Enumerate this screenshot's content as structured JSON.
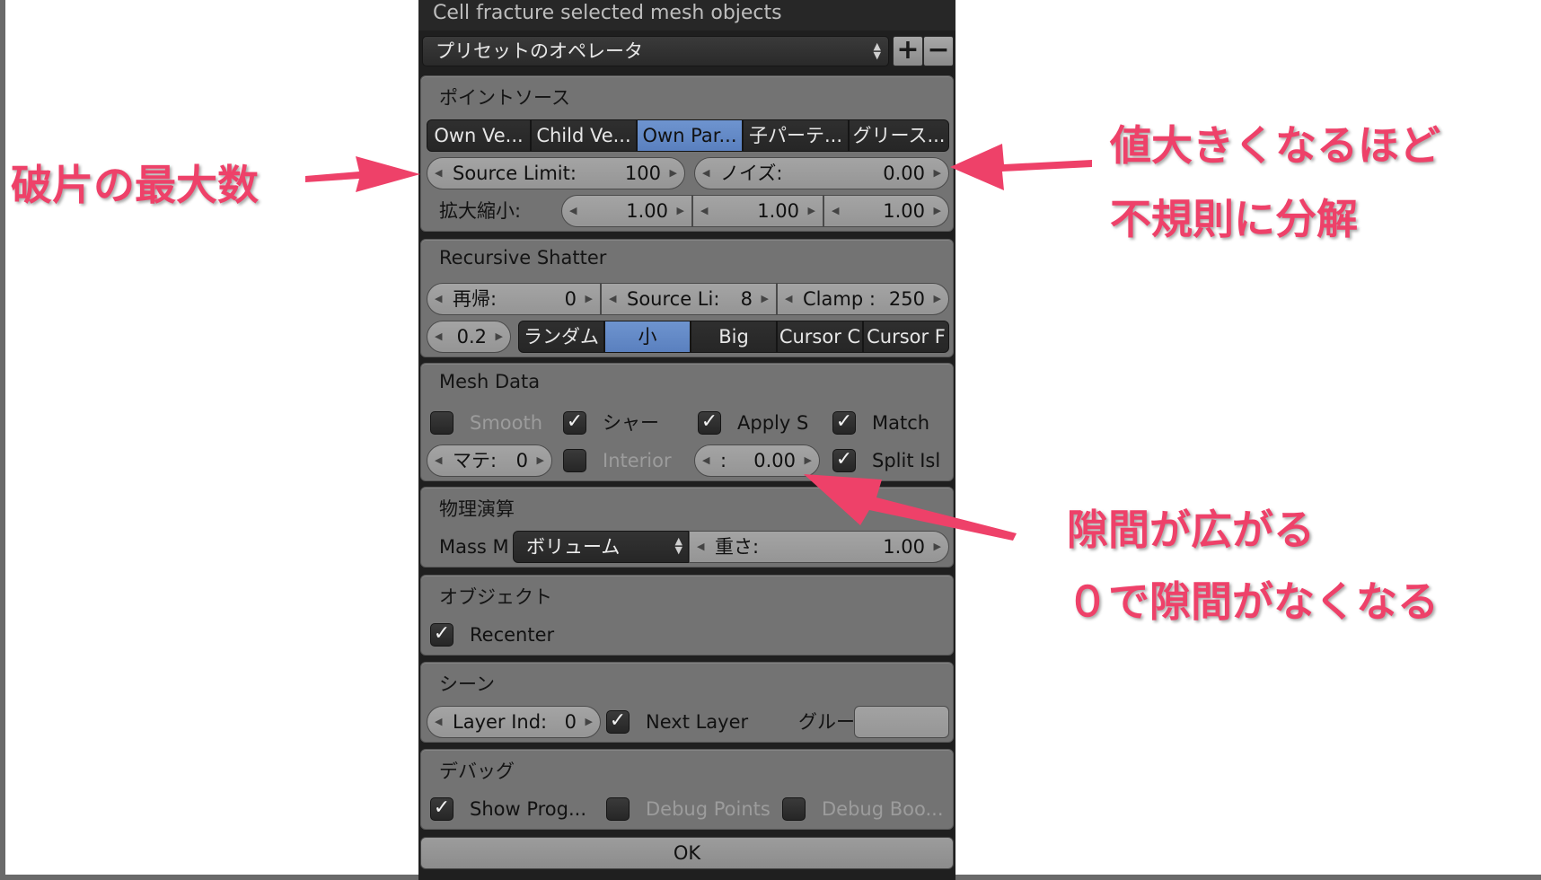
{
  "dialog": {
    "title": "Cell fracture selected mesh objects",
    "preset": "プリセットのオペレータ",
    "add_label": "+",
    "remove_label": "−",
    "ok_label": "OK"
  },
  "point_source": {
    "title": "ポイントソース",
    "tabs": [
      {
        "label": "Own Ve...",
        "active": false
      },
      {
        "label": "Child Ve...",
        "active": false
      },
      {
        "label": "Own Par...",
        "active": true
      },
      {
        "label": "子パーテ...",
        "active": false
      },
      {
        "label": "グリース...",
        "active": false
      }
    ],
    "source_limit": {
      "label": "Source Limit:",
      "value": "100"
    },
    "noise": {
      "label": "ノイズ:",
      "value": "0.00"
    },
    "scale": {
      "label": "拡大縮小:",
      "x": "1.00",
      "y": "1.00",
      "z": "1.00"
    }
  },
  "recursive": {
    "title": "Recursive Shatter",
    "recursion": {
      "label": "再帰:",
      "value": "0"
    },
    "source_limit": {
      "label": "Source Li:",
      "value": "8"
    },
    "clamp": {
      "label": "Clamp :",
      "value": "250"
    },
    "chance": {
      "value": "0.2"
    },
    "modes": [
      {
        "label": "ランダム",
        "active": false
      },
      {
        "label": "小",
        "active": true
      },
      {
        "label": "Big",
        "active": false
      },
      {
        "label": "Cursor C",
        "active": false
      },
      {
        "label": "Cursor F",
        "active": false
      }
    ]
  },
  "mesh_data": {
    "title": "Mesh Data",
    "smooth": {
      "label": "Smooth",
      "checked": false
    },
    "sharp": {
      "label": "シャー",
      "checked": true
    },
    "apply_s": {
      "label": "Apply S",
      "checked": true
    },
    "match": {
      "label": "Match",
      "checked": true
    },
    "material": {
      "label": "マテ:",
      "value": "0"
    },
    "interior": {
      "label": "Interior",
      "checked": false
    },
    "margin": {
      "label": ":",
      "value": "0.00"
    },
    "split_isl": {
      "label": "Split Isl",
      "checked": true
    }
  },
  "physics": {
    "title": "物理演算",
    "mass_label": "Mass M",
    "mass_mode": "ボリューム",
    "mass": {
      "label": "重さ:",
      "value": "1.00"
    }
  },
  "object": {
    "title": "オブジェクト",
    "recenter": {
      "label": "Recenter",
      "checked": true
    }
  },
  "scene": {
    "title": "シーン",
    "layer": {
      "label": "Layer Ind:",
      "value": "0"
    },
    "next_layer": {
      "label": "Next Layer",
      "checked": true
    },
    "group_label": "グルー",
    "group_value": ""
  },
  "debug": {
    "title": "デバッグ",
    "show_prog": {
      "label": "Show Prog...",
      "checked": true
    },
    "debug_points": {
      "label": "Debug Points",
      "checked": false
    },
    "debug_boo": {
      "label": "Debug Boo...",
      "checked": false
    }
  },
  "annotations": {
    "max_pieces": "破片の最大数",
    "noise_line1": "値大きくなるほど",
    "noise_line2": "不規則に分解",
    "margin_line1": "隙間が広がる",
    "margin_line2": "０で隙間がなくなる",
    "color": "#ee4169"
  },
  "colors": {
    "active_toggle": "#5a80bf",
    "box_bg": "#737373",
    "panel_bg": "#1f1f1f"
  }
}
